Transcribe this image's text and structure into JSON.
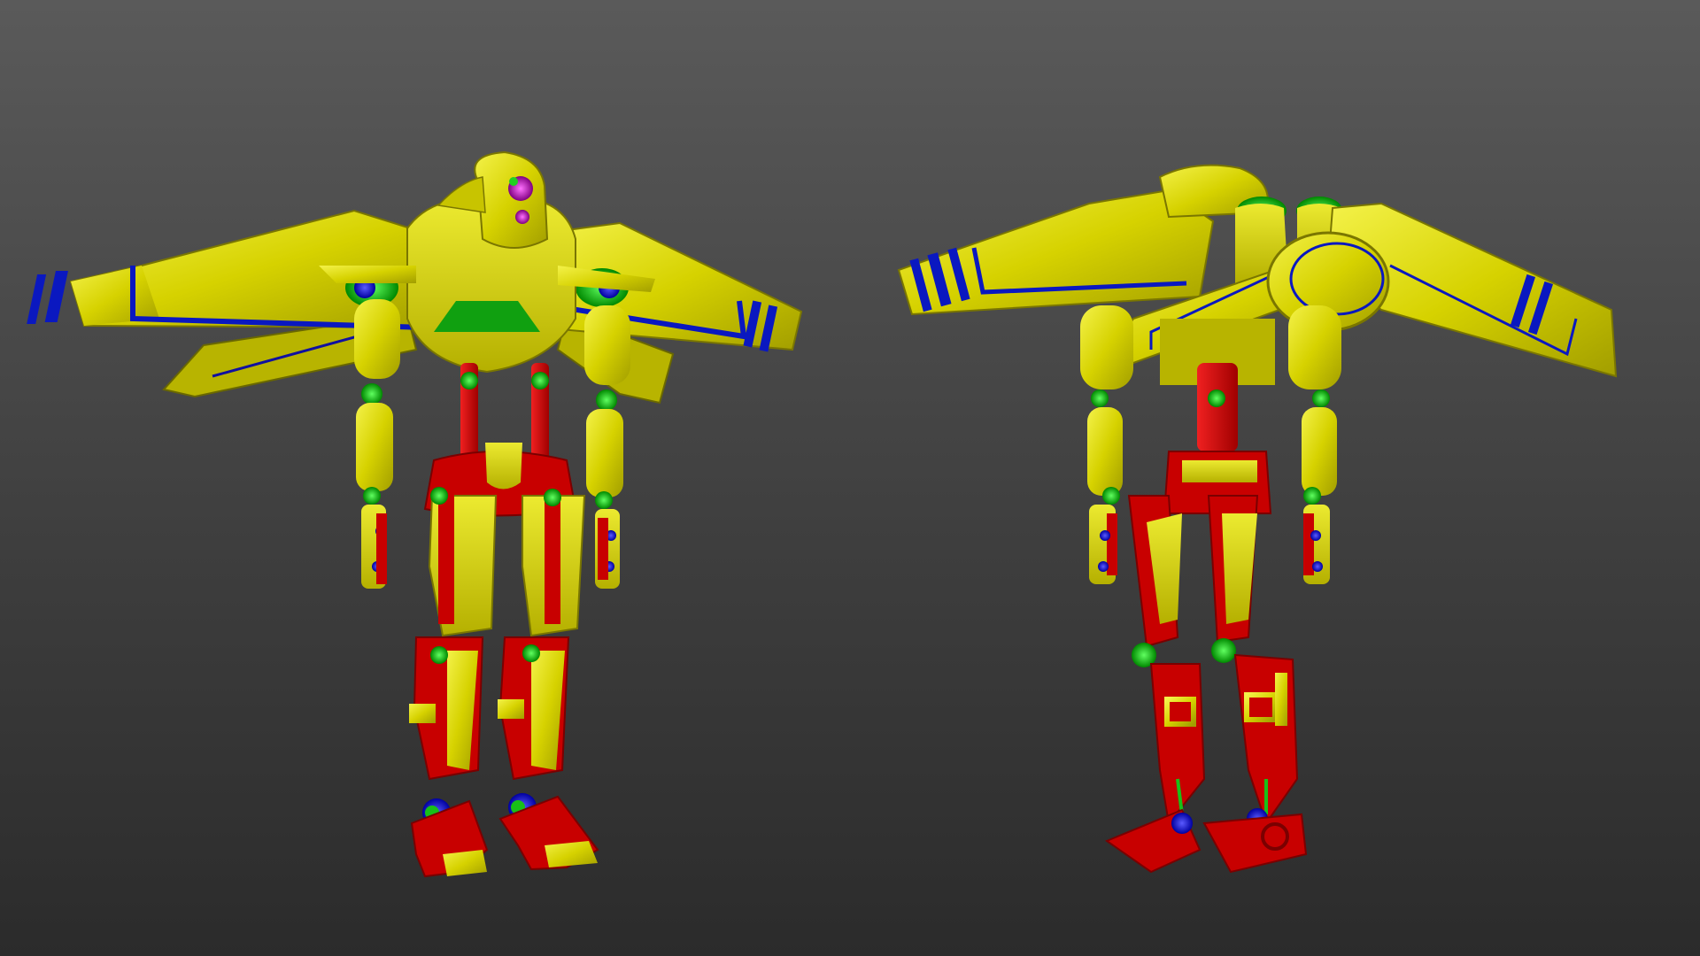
{
  "scene": {
    "models": [
      {
        "view": "front"
      },
      {
        "view": "back"
      }
    ],
    "colors": {
      "background_top": "#5a5a5a",
      "background_bottom": "#2b2b2b",
      "armor_yellow": "#d6d200",
      "armor_yellow_light": "#f0ee3a",
      "armor_yellow_dark": "#9e9a00",
      "frame_red": "#d40000",
      "frame_red_dark": "#8a0000",
      "joint_green": "#10c010",
      "joint_blue": "#1010c8",
      "stripe_blue": "#0a18c0",
      "eye_magenta": "#c020c0"
    }
  }
}
